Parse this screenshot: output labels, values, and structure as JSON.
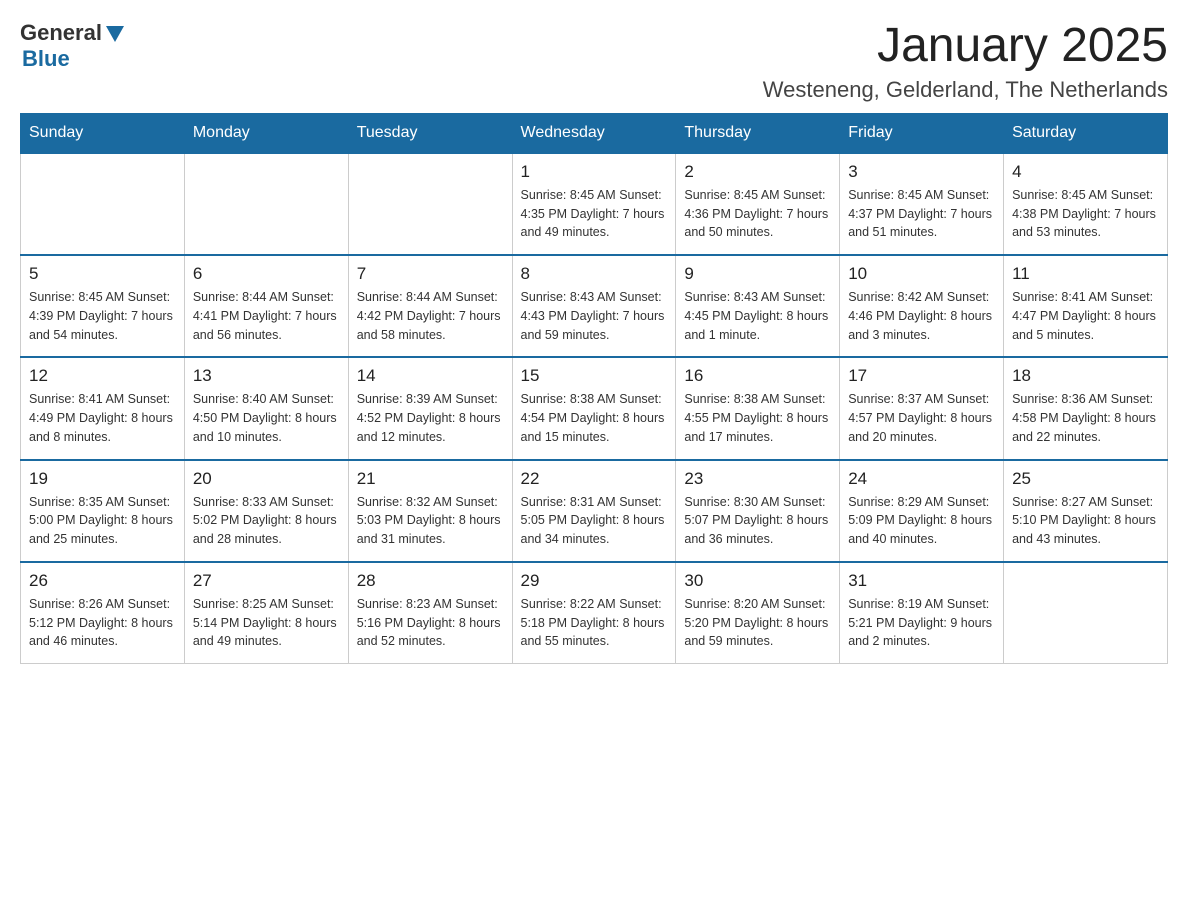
{
  "header": {
    "logo": {
      "general": "General",
      "blue": "Blue"
    },
    "title": "January 2025",
    "subtitle": "Westeneng, Gelderland, The Netherlands"
  },
  "weekdays": [
    "Sunday",
    "Monday",
    "Tuesday",
    "Wednesday",
    "Thursday",
    "Friday",
    "Saturday"
  ],
  "weeks": [
    [
      {
        "day": "",
        "info": ""
      },
      {
        "day": "",
        "info": ""
      },
      {
        "day": "",
        "info": ""
      },
      {
        "day": "1",
        "info": "Sunrise: 8:45 AM\nSunset: 4:35 PM\nDaylight: 7 hours\nand 49 minutes."
      },
      {
        "day": "2",
        "info": "Sunrise: 8:45 AM\nSunset: 4:36 PM\nDaylight: 7 hours\nand 50 minutes."
      },
      {
        "day": "3",
        "info": "Sunrise: 8:45 AM\nSunset: 4:37 PM\nDaylight: 7 hours\nand 51 minutes."
      },
      {
        "day": "4",
        "info": "Sunrise: 8:45 AM\nSunset: 4:38 PM\nDaylight: 7 hours\nand 53 minutes."
      }
    ],
    [
      {
        "day": "5",
        "info": "Sunrise: 8:45 AM\nSunset: 4:39 PM\nDaylight: 7 hours\nand 54 minutes."
      },
      {
        "day": "6",
        "info": "Sunrise: 8:44 AM\nSunset: 4:41 PM\nDaylight: 7 hours\nand 56 minutes."
      },
      {
        "day": "7",
        "info": "Sunrise: 8:44 AM\nSunset: 4:42 PM\nDaylight: 7 hours\nand 58 minutes."
      },
      {
        "day": "8",
        "info": "Sunrise: 8:43 AM\nSunset: 4:43 PM\nDaylight: 7 hours\nand 59 minutes."
      },
      {
        "day": "9",
        "info": "Sunrise: 8:43 AM\nSunset: 4:45 PM\nDaylight: 8 hours\nand 1 minute."
      },
      {
        "day": "10",
        "info": "Sunrise: 8:42 AM\nSunset: 4:46 PM\nDaylight: 8 hours\nand 3 minutes."
      },
      {
        "day": "11",
        "info": "Sunrise: 8:41 AM\nSunset: 4:47 PM\nDaylight: 8 hours\nand 5 minutes."
      }
    ],
    [
      {
        "day": "12",
        "info": "Sunrise: 8:41 AM\nSunset: 4:49 PM\nDaylight: 8 hours\nand 8 minutes."
      },
      {
        "day": "13",
        "info": "Sunrise: 8:40 AM\nSunset: 4:50 PM\nDaylight: 8 hours\nand 10 minutes."
      },
      {
        "day": "14",
        "info": "Sunrise: 8:39 AM\nSunset: 4:52 PM\nDaylight: 8 hours\nand 12 minutes."
      },
      {
        "day": "15",
        "info": "Sunrise: 8:38 AM\nSunset: 4:54 PM\nDaylight: 8 hours\nand 15 minutes."
      },
      {
        "day": "16",
        "info": "Sunrise: 8:38 AM\nSunset: 4:55 PM\nDaylight: 8 hours\nand 17 minutes."
      },
      {
        "day": "17",
        "info": "Sunrise: 8:37 AM\nSunset: 4:57 PM\nDaylight: 8 hours\nand 20 minutes."
      },
      {
        "day": "18",
        "info": "Sunrise: 8:36 AM\nSunset: 4:58 PM\nDaylight: 8 hours\nand 22 minutes."
      }
    ],
    [
      {
        "day": "19",
        "info": "Sunrise: 8:35 AM\nSunset: 5:00 PM\nDaylight: 8 hours\nand 25 minutes."
      },
      {
        "day": "20",
        "info": "Sunrise: 8:33 AM\nSunset: 5:02 PM\nDaylight: 8 hours\nand 28 minutes."
      },
      {
        "day": "21",
        "info": "Sunrise: 8:32 AM\nSunset: 5:03 PM\nDaylight: 8 hours\nand 31 minutes."
      },
      {
        "day": "22",
        "info": "Sunrise: 8:31 AM\nSunset: 5:05 PM\nDaylight: 8 hours\nand 34 minutes."
      },
      {
        "day": "23",
        "info": "Sunrise: 8:30 AM\nSunset: 5:07 PM\nDaylight: 8 hours\nand 36 minutes."
      },
      {
        "day": "24",
        "info": "Sunrise: 8:29 AM\nSunset: 5:09 PM\nDaylight: 8 hours\nand 40 minutes."
      },
      {
        "day": "25",
        "info": "Sunrise: 8:27 AM\nSunset: 5:10 PM\nDaylight: 8 hours\nand 43 minutes."
      }
    ],
    [
      {
        "day": "26",
        "info": "Sunrise: 8:26 AM\nSunset: 5:12 PM\nDaylight: 8 hours\nand 46 minutes."
      },
      {
        "day": "27",
        "info": "Sunrise: 8:25 AM\nSunset: 5:14 PM\nDaylight: 8 hours\nand 49 minutes."
      },
      {
        "day": "28",
        "info": "Sunrise: 8:23 AM\nSunset: 5:16 PM\nDaylight: 8 hours\nand 52 minutes."
      },
      {
        "day": "29",
        "info": "Sunrise: 8:22 AM\nSunset: 5:18 PM\nDaylight: 8 hours\nand 55 minutes."
      },
      {
        "day": "30",
        "info": "Sunrise: 8:20 AM\nSunset: 5:20 PM\nDaylight: 8 hours\nand 59 minutes."
      },
      {
        "day": "31",
        "info": "Sunrise: 8:19 AM\nSunset: 5:21 PM\nDaylight: 9 hours\nand 2 minutes."
      },
      {
        "day": "",
        "info": ""
      }
    ]
  ]
}
